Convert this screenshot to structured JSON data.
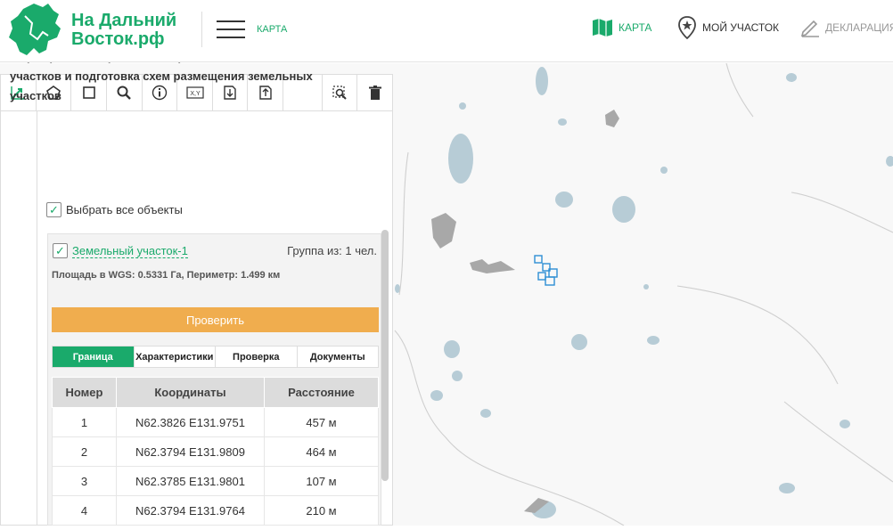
{
  "header": {
    "logo_line1": "На Дальний",
    "logo_line2": "Восток.рф",
    "menu_link": "КАРТА",
    "nav": [
      {
        "label": "КАРТА",
        "icon": "map-icon"
      },
      {
        "label": "МОЙ УЧАСТОК",
        "icon": "location-star-icon"
      },
      {
        "label": "ДЕКЛАРАЦИЯ",
        "icon": "pen-icon"
      }
    ]
  },
  "toolbar": {
    "tools": [
      "draw-edit-icon",
      "polygon-icon",
      "rectangle-icon",
      "search-icon",
      "info-icon",
      "coordinates-icon",
      "import-icon",
      "export-icon",
      "zoom-area-icon",
      "trash-icon"
    ]
  },
  "panel": {
    "title": "Формирование проектов испрашиваемых земельных участков и подготовка схем размещения земельных участков",
    "select_all": "Выбрать все объекты",
    "plot": {
      "name": "Земельный участок-1",
      "group": "Группа из: 1 чел.",
      "area": "Площадь в WGS: 0.5331 Га, Периметр: 1.499 км",
      "check_button": "Проверить"
    },
    "tabs": [
      "Граница",
      "Характеристики",
      "Проверка",
      "Документы"
    ],
    "table": {
      "headers": [
        "Номер",
        "Координаты",
        "Расстояние"
      ],
      "rows": [
        [
          "1",
          "N62.3826 E131.9751",
          "457 м"
        ],
        [
          "2",
          "N62.3794 E131.9809",
          "464 м"
        ],
        [
          "3",
          "N62.3785 E131.9801",
          "107 м"
        ],
        [
          "4",
          "N62.3794 E131.9764",
          "210 м"
        ]
      ]
    }
  },
  "colors": {
    "brand": "#1aaa6b",
    "button": "#f0ad4e"
  }
}
